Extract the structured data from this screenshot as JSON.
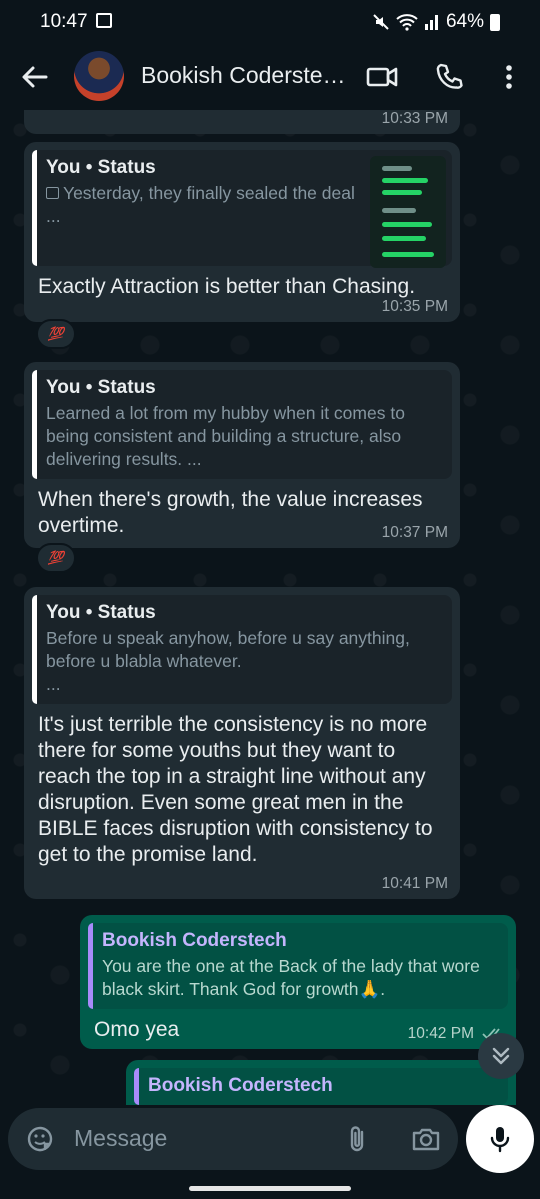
{
  "status_bar": {
    "time": "10:47",
    "battery": "64%"
  },
  "header": {
    "title": "Bookish Coderste…"
  },
  "partial_top": {
    "time": "10:33 PM"
  },
  "messages": [
    {
      "quote_author": "You • Status",
      "quote_text": "Yesterday, they finally sealed the deal",
      "quote_more": "...",
      "text": "Exactly Attraction is better than Chasing.",
      "time": "10:35 PM",
      "reaction": "💯"
    },
    {
      "quote_author": "You • Status",
      "quote_text": "Learned a lot from my hubby when it comes to being consistent and building a structure, also delivering results. ...",
      "text": "When there's growth, the value increases overtime.",
      "time": "10:37 PM",
      "reaction": "💯"
    },
    {
      "quote_author": "You • Status",
      "quote_text": "Before u speak anyhow, before u say anything, before u blabla whatever.",
      "quote_more": "...",
      "text": "It's just terrible the consistency is no more there for some youths but they want to reach the top in a straight line without any disruption. Even some great men in the BIBLE faces disruption with consistency to get to the promise land.",
      "time": "10:41 PM"
    },
    {
      "quote_author": "Bookish Coderstech",
      "quote_text": "You are the one at the Back of the lady that wore black skirt. Thank God for growth🙏.",
      "text": "Omo yea",
      "time": "10:42 PM"
    },
    {
      "quote_author": "Bookish Coderstech"
    }
  ],
  "input": {
    "placeholder": "Message"
  },
  "colors": {
    "incoming": "#202c33",
    "outgoing": "#005c4b",
    "background": "#0b141a"
  }
}
